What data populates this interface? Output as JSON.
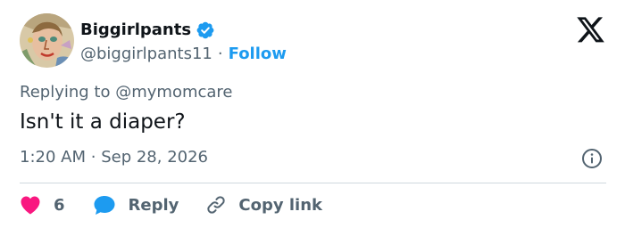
{
  "author": {
    "display_name": "Biggirlpants",
    "handle": "@biggirlpants11",
    "verified": true,
    "separator": "·",
    "follow_label": "Follow",
    "avatar_icon": "avatar-portrait-painting"
  },
  "header": {
    "logo_icon": "x-logo-icon"
  },
  "tweet": {
    "replying_prefix": "Replying to",
    "replying_to": "@mymomcare",
    "text": "Isn't it a diaper?",
    "time": "1:20 AM",
    "meta_separator": "·",
    "date": "Sep 28, 2026"
  },
  "actions": {
    "like_count": "6",
    "reply_label": "Reply",
    "copy_label": "Copy link"
  },
  "colors": {
    "accent": "#1d9bf0",
    "like": "#f91880",
    "text_primary": "#0f1419",
    "text_secondary": "#536471",
    "divider": "#cfd9de"
  }
}
